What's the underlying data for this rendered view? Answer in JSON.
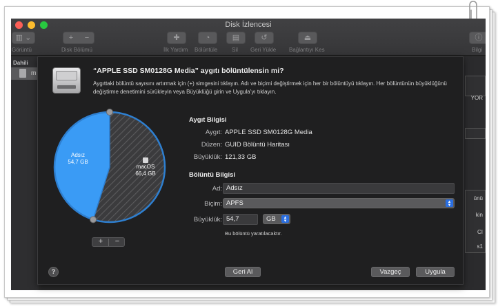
{
  "window": {
    "title": "Disk İzlencesi"
  },
  "toolbar": {
    "view_label": "Görüntü",
    "volume_label": "Disk Bölümü",
    "volume_add": "+",
    "volume_remove": "−",
    "first_aid_label": "İlk Yardım",
    "partition_label": "Bölüntüle",
    "erase_label": "Sil",
    "restore_label": "Geri Yükle",
    "unmount_label": "Bağlantıyı Kes",
    "info_label": "Bilgi"
  },
  "sidebar": {
    "section": "Dahili",
    "item_initial": "m"
  },
  "right_panel": {
    "texts": [
      "YOR",
      "ünü",
      "kin",
      "CI",
      "s1"
    ]
  },
  "dialog": {
    "title": "“APPLE SSD SM0128G Media” aygıtı bölüntülensin mi?",
    "description": "Aygıttaki bölüntü sayısını artırmak için (+) simgesini tıklayın. Adı ve biçimi değiştirmek için her bir bölüntüyü tıklayın. Her bölüntünün büyüklüğünü değiştirme denetimini sürükleyin veya Büyüklüğü girin ve Uygula’yı tıklayın.",
    "device_info": {
      "heading": "Aygıt Bilgisi",
      "device_label": "Aygıt:",
      "device_value": "APPLE SSD SM0128G Media",
      "scheme_label": "Düzen:",
      "scheme_value": "GUID Bölüntü Haritası",
      "size_label": "Büyüklük:",
      "size_value": "121,33 GB"
    },
    "partition_info": {
      "heading": "Bölüntü Bilgisi",
      "name_label": "Ad:",
      "name_value": "Adsız",
      "format_label": "Biçim:",
      "format_value": "APFS",
      "size_label": "Büyüklük:",
      "size_value": "54,7",
      "unit_value": "GB",
      "note": "Bu bölüntü yaratılacaktır."
    },
    "add_label": "+",
    "remove_label": "−",
    "help_label": "?",
    "revert_label": "Geri Al",
    "cancel_label": "Vazgeç",
    "apply_label": "Uygula"
  },
  "chart_data": {
    "type": "pie",
    "slices": [
      {
        "name": "Adsız",
        "value": 54.7,
        "value_label": "54,7 GB",
        "color": "#3a9bf5"
      },
      {
        "name": "macOS",
        "value": 66.4,
        "value_label": "66,4 GB",
        "color": "#3b3b3d"
      }
    ]
  },
  "colors": {
    "accent": "#2a6ee0",
    "new_partition": "#3a9bf5"
  }
}
